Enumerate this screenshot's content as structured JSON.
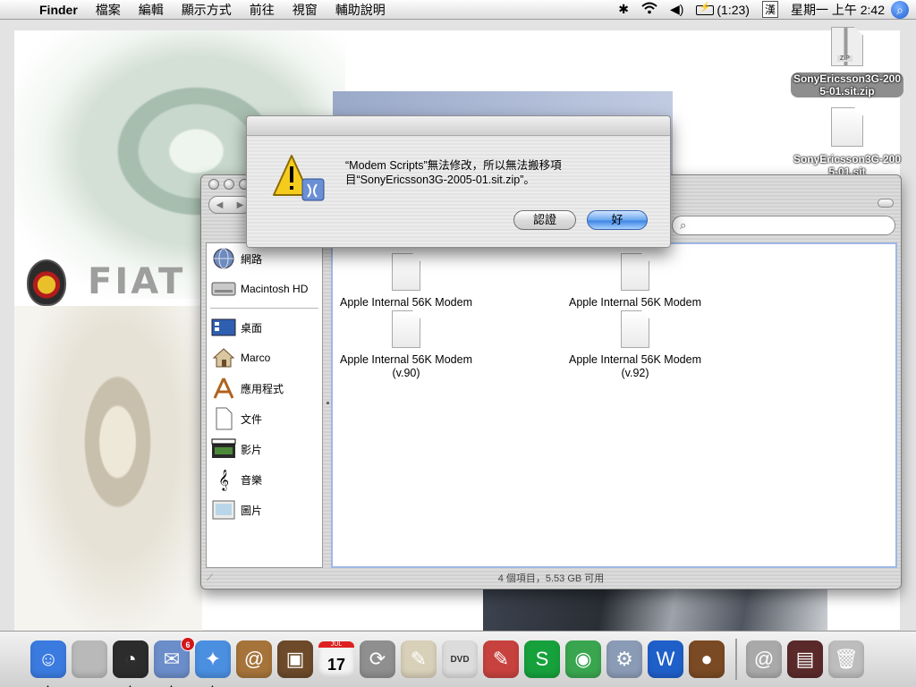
{
  "menubar": {
    "app_name": "Finder",
    "menus": [
      "檔案",
      "編輯",
      "顯示方式",
      "前往",
      "視窗",
      "輔助說明"
    ],
    "battery_time": "(1:23)",
    "input_method": "漢",
    "clock": "星期一 上午 2:42",
    "icons": [
      "apple-icon",
      "bluetooth-icon",
      "wifi-icon",
      "volume-icon",
      "battery-icon",
      "spotlight-icon"
    ]
  },
  "desktop": {
    "icons": [
      {
        "label": "SonyEricsson3G-2005-01.sit.zip",
        "line1": "SonyEricsson3G-200",
        "line2": "5-01.sit.zip",
        "type": "zip",
        "tag": "ZIP"
      },
      {
        "label": "SonyEricsson3G-2005-01.sit",
        "line1": "SonyEricsson3G-200",
        "line2": "5-01.sit",
        "type": "doc"
      }
    ],
    "wallpaper_text": "FIAT"
  },
  "alert": {
    "message_line1": "“Modem Scripts”無法修改，所以無法搬移項",
    "message_line2": "目“SonyEricsson3G-2005-01.sit.zip”。",
    "cancel_label": "認證",
    "ok_label": "好"
  },
  "finder": {
    "sidebar": {
      "devices": [
        {
          "label": "網路",
          "icon": "network-globe-icon"
        },
        {
          "label": "Macintosh HD",
          "icon": "hard-drive-icon"
        }
      ],
      "places": [
        {
          "label": "桌面",
          "icon": "desktop-icon"
        },
        {
          "label": "Marco",
          "icon": "home-icon"
        },
        {
          "label": "應用程式",
          "icon": "applications-icon"
        },
        {
          "label": "文件",
          "icon": "documents-icon"
        },
        {
          "label": "影片",
          "icon": "movies-icon"
        },
        {
          "label": "音樂",
          "icon": "music-icon"
        },
        {
          "label": "圖片",
          "icon": "pictures-icon"
        }
      ]
    },
    "files": [
      {
        "line1": "Apple Internal 56K Modem",
        "line2": ""
      },
      {
        "line1": "Apple Internal 56K Modem",
        "line2": ""
      },
      {
        "line1": "Apple Internal 56K Modem",
        "line2": "(v.90)"
      },
      {
        "line1": "Apple Internal 56K Modem",
        "line2": "(v.92)"
      }
    ],
    "status": "4 個項目，5.53 GB 可用"
  },
  "dock": {
    "apps": [
      {
        "name": "finder-icon",
        "color": "#3b7be0",
        "running": true
      },
      {
        "name": "apple-icon",
        "color": "#b9b9b9",
        "running": false
      },
      {
        "name": "dashboard-icon",
        "color": "#2c2c2c",
        "running": true
      },
      {
        "name": "mail-icon",
        "color": "#6b8dc9",
        "running": true,
        "badge": "6"
      },
      {
        "name": "safari-icon",
        "color": "#4a8fe0",
        "running": true
      },
      {
        "name": "address-book-icon",
        "color": "#a6743a",
        "running": false
      },
      {
        "name": "iphoto-icon",
        "color": "#6c4a2a",
        "running": false
      },
      {
        "name": "ical-icon",
        "color": "#f4f4f4",
        "running": false,
        "month": "JUL",
        "day": "17"
      },
      {
        "name": "sync-icon",
        "color": "#8f8f8f",
        "running": false
      },
      {
        "name": "preview-icon",
        "color": "#d8d0b8",
        "running": false
      },
      {
        "name": "ipod-icon",
        "color": "#dcdcdc",
        "running": false,
        "label": "DVD"
      },
      {
        "name": "dictionary-icon",
        "color": "#c7423e",
        "running": false
      },
      {
        "name": "skype-icon",
        "color": "#16a13c",
        "running": false
      },
      {
        "name": "adium-icon",
        "color": "#39a64f",
        "running": false
      },
      {
        "name": "automator-icon",
        "color": "#8a9bb5",
        "running": false
      },
      {
        "name": "word-icon",
        "color": "#1f5fc9",
        "running": false
      },
      {
        "name": "coconut-icon",
        "color": "#7a4a24",
        "running": false
      }
    ],
    "docs": [
      {
        "name": "mail-at-icon",
        "color": "#a9a9a9"
      },
      {
        "name": "screen-stack-icon",
        "color": "#5a2a2a"
      },
      {
        "name": "trash-icon",
        "color": "#bdbdbd"
      }
    ]
  }
}
